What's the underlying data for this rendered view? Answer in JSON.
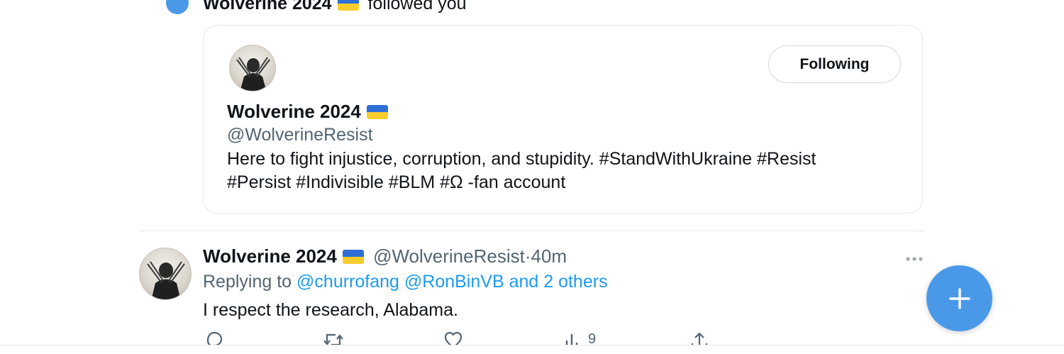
{
  "notification": {
    "name": "Wolverine 2024",
    "text": "followed you",
    "icon": "person-icon"
  },
  "card": {
    "name": "Wolverine 2024",
    "handle": "@WolverineResist",
    "bio_line1": "Here to fight injustice, corruption, and stupidity. #StandWithUkraine #Resist",
    "bio_line2": "#Persist #Indivisible #BLM #Ω -fan account",
    "following_label": "Following"
  },
  "tweet": {
    "name": "Wolverine 2024",
    "handle": "@WolverineResist",
    "separator": "·",
    "time": "40m",
    "replying_prefix": "Replying to",
    "reply_to_1": "@churrofang",
    "reply_to_2": "@RonBinVB",
    "reply_others": "and 2 others",
    "text": "I respect the research, Alabama.",
    "views_count": "9"
  },
  "icons": {
    "flag": "ukraine-flag-icon",
    "reply": "reply-icon",
    "retweet": "retweet-icon",
    "like": "like-icon",
    "views": "views-icon",
    "share": "share-icon",
    "more": "more-icon",
    "compose": "compose-plus-icon"
  },
  "colors": {
    "accent": "#1d9bf0",
    "fab": "#4a99e9",
    "secondary_text": "#536471",
    "flag_blue": "#2d6fd6",
    "flag_yellow": "#f7cd2e"
  }
}
